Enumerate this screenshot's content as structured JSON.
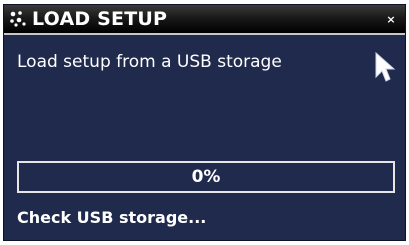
{
  "window": {
    "title": "LOAD SETUP",
    "title_icon": "dots-grid-icon",
    "close_icon": "close-icon",
    "close_symbol": "×"
  },
  "main": {
    "message": "Load setup from a USB storage",
    "progress": {
      "value": 0,
      "label": "0%"
    },
    "status": "Check USB storage..."
  },
  "colors": {
    "background": "#1f2a4c",
    "titlebar": "#000000",
    "text": "#ffffff",
    "progress_border": "#e6e6e6"
  },
  "icons": {
    "cursor": "mouse-pointer-icon"
  }
}
